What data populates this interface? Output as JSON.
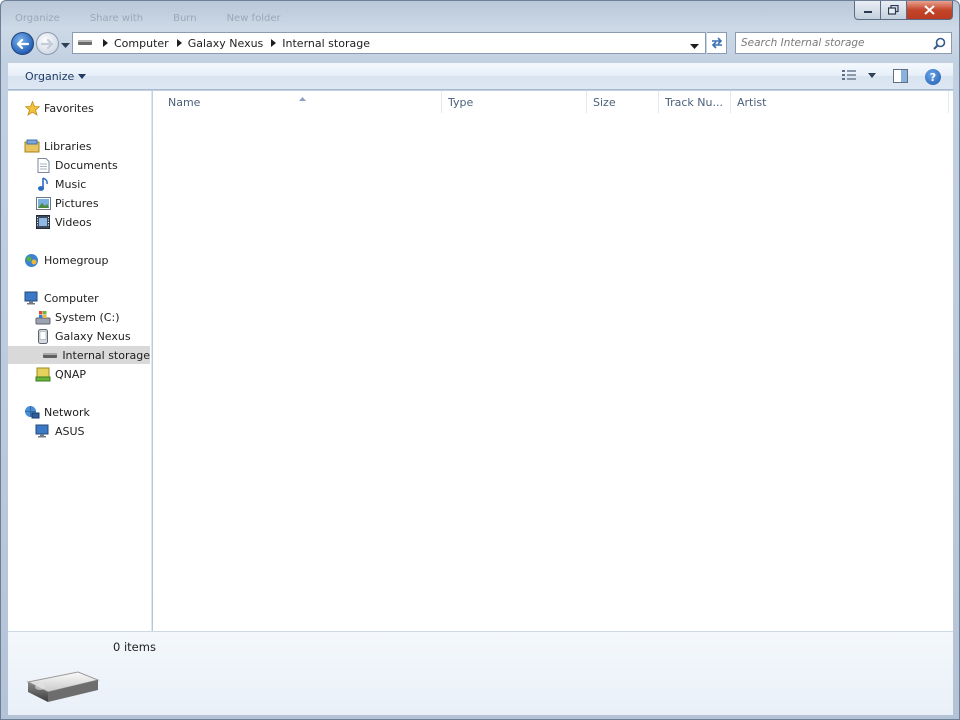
{
  "window": {
    "ghost_menu": [
      "Organize",
      "Share with",
      "Burn",
      "New folder"
    ]
  },
  "address": {
    "breadcrumbs": [
      "Computer",
      "Galaxy Nexus",
      "Internal storage"
    ]
  },
  "search": {
    "placeholder": "Search Internal storage"
  },
  "toolbar": {
    "organize_label": "Organize"
  },
  "nav": {
    "favorites": "Favorites",
    "libraries": "Libraries",
    "libraries_items": [
      "Documents",
      "Music",
      "Pictures",
      "Videos"
    ],
    "homegroup": "Homegroup",
    "computer": "Computer",
    "computer_items": [
      "System (C:)",
      "Galaxy Nexus",
      "Internal storage",
      "QNAP"
    ],
    "network": "Network",
    "network_items": [
      "ASUS"
    ]
  },
  "columns": [
    "Name",
    "Type",
    "Size",
    "Track Nu...",
    "Artist"
  ],
  "status": {
    "items_count": "0 items"
  },
  "colors": {
    "selected": "#d9d9d9",
    "accent": "#2661b7",
    "header_text": "#4c607a"
  }
}
